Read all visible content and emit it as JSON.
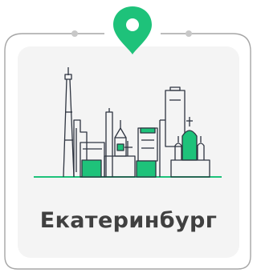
{
  "city": {
    "name": "Екатеринбург"
  },
  "colors": {
    "accent_green": "#1ec27a",
    "frame_stroke": "#a6a6a6",
    "card_bg": "#f4f4f4",
    "line_ink": "#2e3440",
    "text": "#404040"
  },
  "icons": {
    "pin": "map-pin-icon",
    "skyline": "city-skyline-illustration"
  }
}
